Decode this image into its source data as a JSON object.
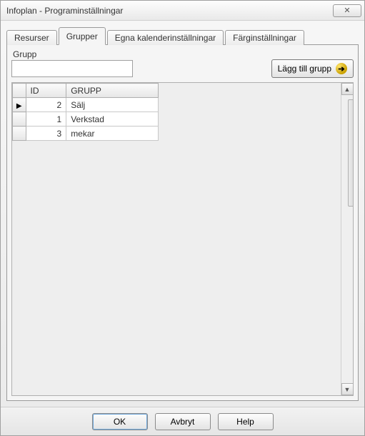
{
  "window": {
    "title": "Infoplan - Programinställningar",
    "close_glyph": "✕"
  },
  "tabs": [
    {
      "label": "Resurser",
      "active": false
    },
    {
      "label": "Grupper",
      "active": true
    },
    {
      "label": "Egna kalenderinställningar",
      "active": false
    },
    {
      "label": "Färginställningar",
      "active": false
    }
  ],
  "form": {
    "grupp_label": "Grupp",
    "grupp_value": "",
    "add_button_label": "Lägg till grupp"
  },
  "table": {
    "columns": {
      "id": "ID",
      "grupp": "GRUPP"
    },
    "rows": [
      {
        "marker": "▶",
        "id": "2",
        "grupp": "Sälj"
      },
      {
        "marker": "",
        "id": "1",
        "grupp": "Verkstad"
      },
      {
        "marker": "",
        "id": "3",
        "grupp": "mekar"
      }
    ]
  },
  "footer": {
    "ok": "OK",
    "cancel": "Avbryt",
    "help": "Help"
  }
}
